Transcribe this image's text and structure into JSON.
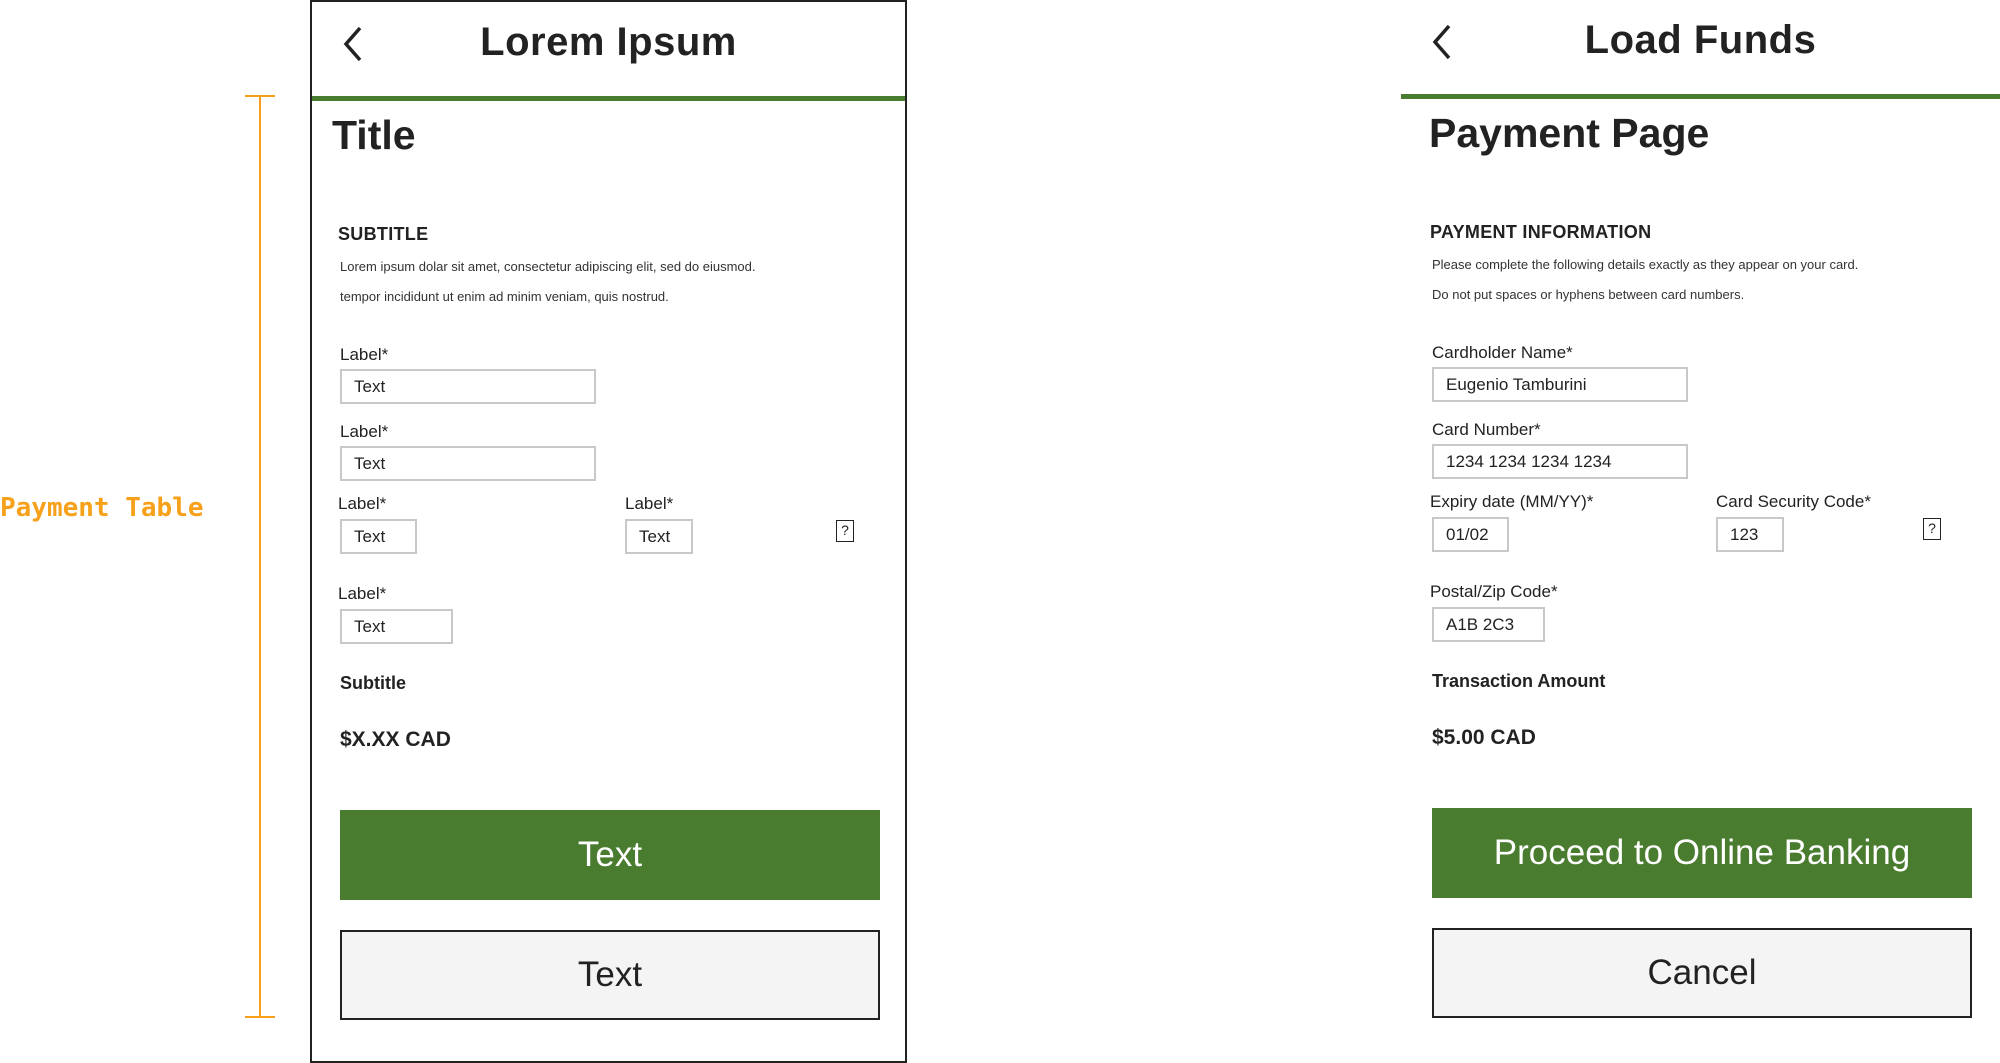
{
  "annotation": {
    "label": "Payment Table",
    "color": "#f7a11a"
  },
  "template": {
    "header_title": "Lorem Ipsum",
    "page_title": "Title",
    "section_title": "SUBTITLE",
    "description": [
      "Lorem ipsum dolar sit amet, consectetur adipiscing elit, sed do eiusmod.",
      "tempor incididunt ut enim ad minim veniam, quis nostrud."
    ],
    "fields": {
      "name": {
        "label": "Label*",
        "value": "Text"
      },
      "card": {
        "label": "Label*",
        "value": "Text"
      },
      "expiry": {
        "label": "Label*",
        "value": "Text"
      },
      "cvc": {
        "label": "Label*",
        "value": "Text"
      },
      "postal": {
        "label": "Label*",
        "value": "Text"
      }
    },
    "help_glyph": "?",
    "amount_label": "Subtitle",
    "amount_value": "$X.XX CAD",
    "primary_button": "Text",
    "secondary_button": "Text"
  },
  "payment": {
    "header_title": "Load Funds",
    "page_title": "Payment Page",
    "section_title": "PAYMENT INFORMATION",
    "description": [
      "Please complete the following details exactly as they appear on your card.",
      "Do not put spaces or hyphens between card numbers."
    ],
    "fields": {
      "name": {
        "label": "Cardholder Name*",
        "value": "Eugenio Tamburini"
      },
      "card": {
        "label": "Card Number*",
        "value": "1234 1234 1234 1234"
      },
      "expiry": {
        "label": "Expiry date (MM/YY)*",
        "value": "01/02"
      },
      "cvc": {
        "label": "Card Security Code*",
        "value": "123"
      },
      "postal": {
        "label": "Postal/Zip Code*",
        "value": "A1B 2C3"
      }
    },
    "help_glyph": "?",
    "amount_label": "Transaction Amount",
    "amount_value": "$5.00 CAD",
    "primary_button": "Proceed to Online Banking",
    "secondary_button": "Cancel"
  },
  "colors": {
    "brand_green": "#4a7c2f",
    "input_border": "#c8c8c8",
    "secondary_bg": "#f4f4f4"
  }
}
